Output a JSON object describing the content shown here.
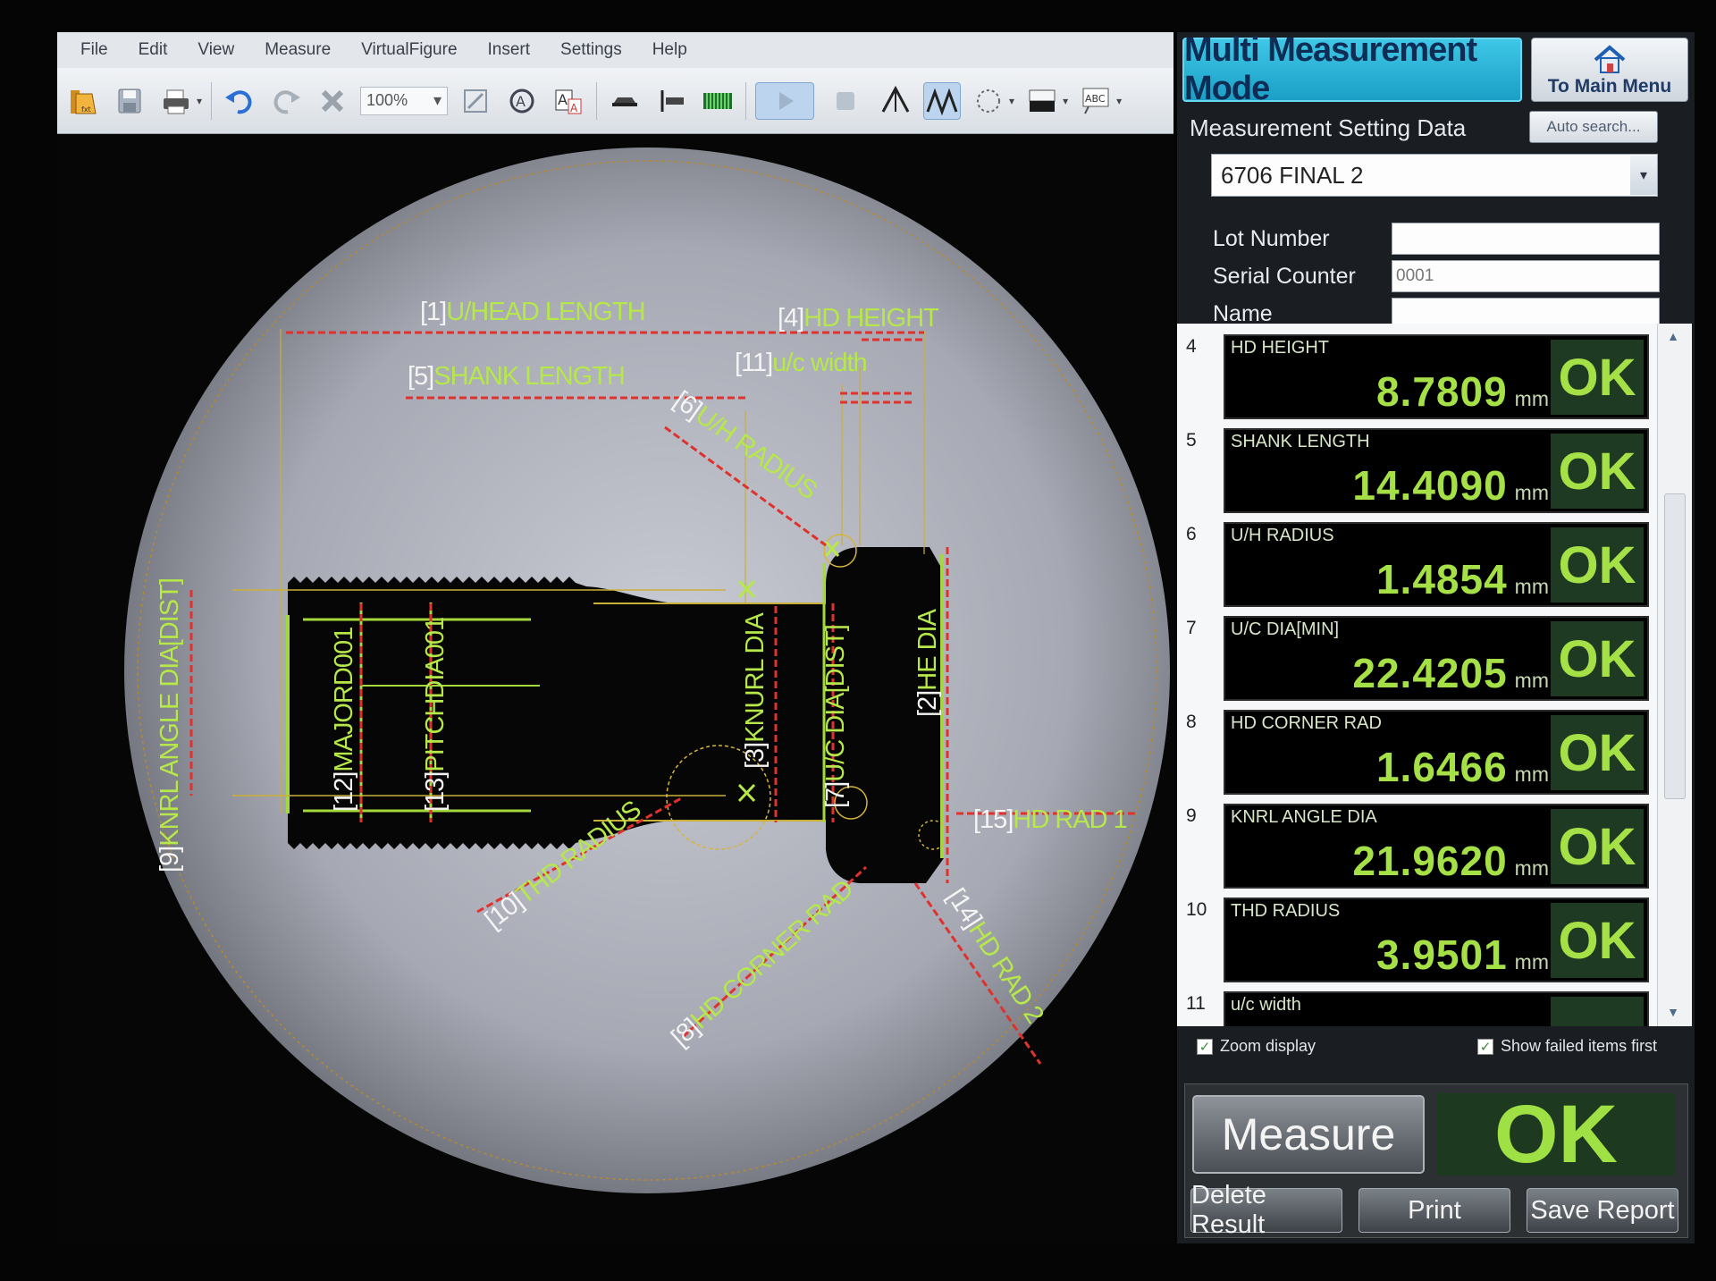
{
  "menu": [
    "File",
    "Edit",
    "View",
    "Measure",
    "VirtualFigure",
    "Insert",
    "Settings",
    "Help"
  ],
  "toolbar": {
    "zoom": "100%",
    "icons": [
      "open-icon",
      "save-icon",
      "print-icon",
      "undo-icon",
      "redo-icon",
      "delete-icon",
      "zoom-dropdown",
      "fit-icon",
      "auto-detect-icon",
      "text-icon",
      "edge-horizontal-icon",
      "edge-vertical-icon",
      "color-bar-icon",
      "play-icon",
      "stop-icon",
      "peak-icon",
      "multi-peak-icon",
      "circle-select-icon",
      "fill-color-icon",
      "label-icon"
    ]
  },
  "labels": {
    "l1": {
      "br": "[1]",
      "tx": "U/HEAD LENGTH"
    },
    "l2": {
      "br": "[2]",
      "tx": "HE DIA"
    },
    "l3": {
      "br": "[3]",
      "tx": "KNURL DIA"
    },
    "l4": {
      "br": "[4]",
      "tx": "HD HEIGHT"
    },
    "l5": {
      "br": "[5]",
      "tx": "SHANK LENGTH"
    },
    "l6": {
      "br": "[6]",
      "tx": "U/H RADIUS"
    },
    "l7": {
      "br": "[7]",
      "tx": "U/C DIA[DIST]"
    },
    "l8": {
      "br": "[8]",
      "tx": "HD CORNER RAD"
    },
    "l9": {
      "br": "[9]",
      "tx": "KNRL ANGLE DIA[DIST]"
    },
    "l10": {
      "br": "[10]",
      "tx": "THD RADIUS"
    },
    "l11": {
      "br": "[11]",
      "tx": "u/c width"
    },
    "l12": {
      "br": "[12]",
      "tx": "MAJORD001"
    },
    "l13": {
      "br": "[13]",
      "tx": "PITCHDIA001"
    },
    "l14": {
      "br": "[14]",
      "tx": "HD RAD 2"
    },
    "l15": {
      "br": "[15]",
      "tx": "HD RAD 1"
    }
  },
  "panel": {
    "title": "Multi Measurement Mode",
    "main_menu": "To Main Menu",
    "setting_label": "Measurement Setting Data",
    "auto_search": "Auto search...",
    "setting_value": "6706 FINAL 2",
    "fields": {
      "lot": {
        "label": "Lot Number",
        "value": ""
      },
      "serial": {
        "label": "Serial Counter",
        "value": "0001"
      },
      "name": {
        "label": "Name",
        "value": ""
      }
    },
    "results": [
      {
        "num": "4",
        "name": "HD HEIGHT",
        "value": "8.7809",
        "unit": "mm",
        "status": "OK"
      },
      {
        "num": "5",
        "name": "SHANK LENGTH",
        "value": "14.4090",
        "unit": "mm",
        "status": "OK"
      },
      {
        "num": "6",
        "name": "U/H RADIUS",
        "value": "1.4854",
        "unit": "mm",
        "status": "OK"
      },
      {
        "num": "7",
        "name": "U/C DIA[MIN]",
        "value": "22.4205",
        "unit": "mm",
        "status": "OK"
      },
      {
        "num": "8",
        "name": "HD CORNER RAD",
        "value": "1.6466",
        "unit": "mm",
        "status": "OK"
      },
      {
        "num": "9",
        "name": "KNRL ANGLE DIA",
        "value": "21.9620",
        "unit": "mm",
        "status": "OK"
      },
      {
        "num": "10",
        "name": "THD RADIUS",
        "value": "3.9501",
        "unit": "mm",
        "status": "OK"
      },
      {
        "num": "11",
        "name": "u/c width",
        "value": "",
        "unit": "",
        "status": ""
      }
    ],
    "zoom_display": "Zoom display",
    "show_failed": "Show failed items first",
    "measure": "Measure",
    "overall": "OK",
    "delete_result": "Delete Result",
    "print": "Print",
    "save_report": "Save Report"
  }
}
